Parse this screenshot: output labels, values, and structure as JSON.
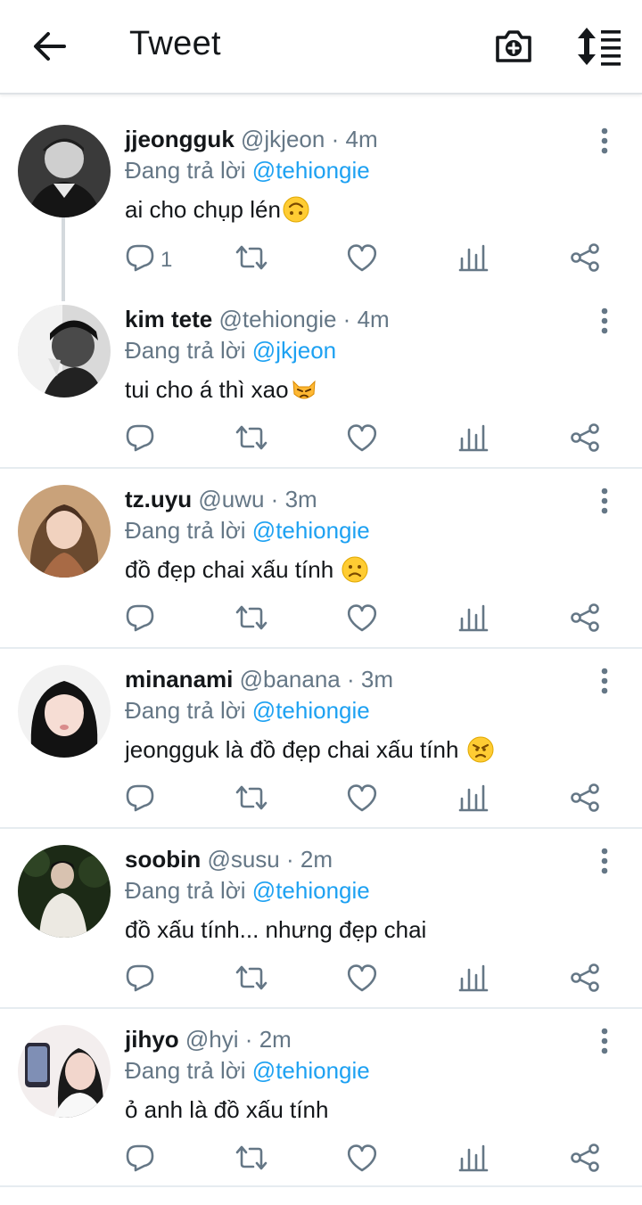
{
  "header": {
    "title": "Tweet"
  },
  "reply_prefix": "Đang trả lời",
  "tweets": [
    {
      "name": "jjeongguk",
      "handle": "@jkjeon",
      "sep": "·",
      "time": "4m",
      "reply_to": "@tehiongie",
      "text": "ai cho chụp lén",
      "emoji": "upside-down-face-emoji",
      "reply_count": "1"
    },
    {
      "name": "kim tete",
      "handle": "@tehiongie",
      "sep": "·",
      "time": "4m",
      "reply_to": "@jkjeon",
      "text": "tui cho á thì xao",
      "emoji": "pouting-cat-emoji",
      "reply_count": ""
    },
    {
      "name": "tz.uyu",
      "handle": "@uwu",
      "sep": "·",
      "time": "3m",
      "reply_to": "@tehiongie",
      "text": "đồ đẹp chai xấu tính ",
      "emoji": "slightly-frowning-face-emoji",
      "reply_count": ""
    },
    {
      "name": "minanami",
      "handle": "@banana",
      "sep": "·",
      "time": "3m",
      "reply_to": "@tehiongie",
      "text": "jeongguk là đồ đẹp chai xấu tính ",
      "emoji": "angry-face-emoji",
      "reply_count": ""
    },
    {
      "name": "soobin",
      "handle": "@susu",
      "sep": "·",
      "time": "2m",
      "reply_to": "@tehiongie",
      "text": "đồ xấu tính... nhưng đẹp chai",
      "emoji": "",
      "reply_count": ""
    },
    {
      "name": "jihyo",
      "handle": "@hyi",
      "sep": "·",
      "time": "2m",
      "reply_to": "@tehiongie",
      "text": "ỏ anh là đồ xấu tính",
      "emoji": "",
      "reply_count": ""
    }
  ],
  "colors": {
    "link": "#1da1f2",
    "muted": "#657786",
    "text": "#14171a",
    "divider": "#e6ecf0"
  }
}
